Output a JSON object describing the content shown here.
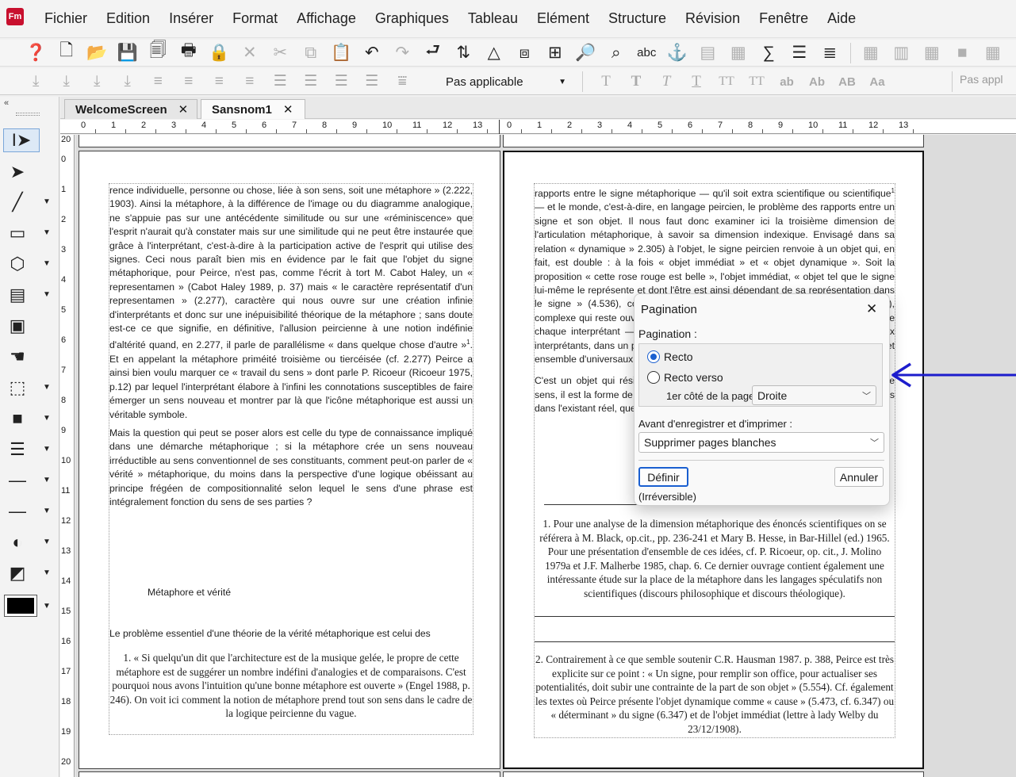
{
  "menubar": {
    "logo": "Fm",
    "items": [
      "Fichier",
      "Edition",
      "Insérer",
      "Format",
      "Affichage",
      "Graphiques",
      "Tableau",
      "Elément",
      "Structure",
      "Révision",
      "Fenêtre",
      "Aide"
    ]
  },
  "toolbar2": {
    "paragraph_format": "Pas applicable",
    "character_format": "Pas appl"
  },
  "tabs": [
    {
      "label": "WelcomeScreen",
      "close": "✕"
    },
    {
      "label": "Sansnom1",
      "close": "✕"
    }
  ],
  "ruler": {
    "h_left": [
      "0",
      "1",
      "2",
      "3",
      "4",
      "5",
      "6",
      "7",
      "8",
      "9",
      "10",
      "11",
      "12",
      "13"
    ],
    "h_right": [
      "0",
      "1",
      "2",
      "3",
      "4",
      "5",
      "6",
      "7",
      "8",
      "9",
      "10",
      "11",
      "12",
      "13"
    ],
    "v": [
      "20",
      "0",
      "1",
      "2",
      "3",
      "4",
      "5",
      "6",
      "7",
      "8",
      "9",
      "10",
      "11",
      "12",
      "13",
      "14",
      "15",
      "16",
      "17",
      "18",
      "19",
      "20"
    ]
  },
  "left_page": {
    "para1": "rence individuelle, personne ou chose, liée à son sens, soit une métaphore » (2.222, 1903). Ainsi la métaphore, à la différence de l'image ou du diagramme analogique, ne s'appuie pas sur une antécédente similitude ou sur une «réminiscence» que l'esprit n'aurait qu'à constater mais sur une similitude qui ne peut être instaurée que grâce à l'interprétant, c'est-à-dire à la participation active de l'esprit qui utilise des signes. Ceci nous paraît bien mis en évidence par le fait que l'objet du signe métaphorique, pour Peirce, n'est pas, comme l'écrit à tort M. Cabot Haley, un « representamen » (Cabot Haley 1989, p. 37) mais « le caractère représentatif d'un representamen » (2.277), caractère qui nous ouvre sur une création infinie d'interprétants et donc sur une inépuisibilité théorique de la métaphore ; sans doute est-ce ce que signifie, en définitive, l'allusion peircienne à une notion indéfinie d'altérité quand, en 2.277, il parle de parallélisme « dans quelque chose d'autre »",
    "para1_sup": "1",
    "para1_end": ". Et en appelant la métaphore priméité troisième ou tiercéisée (cf. 2.277) Peirce a ainsi bien voulu marquer ce « travail du sens » dont parle P. Ricoeur (Ricoeur 1975, p.12) par lequel l'interprétant élabore à l'infini les connotations susceptibles de faire émerger un sens nouveau et montrer par là que l'icône métaphorique est aussi un véritable symbole.",
    "para2": "Mais la question qui peut se poser alors est celle du type de connaissance impliqué dans une démarche métaphorique ; si la métaphore crée un sens nouveau irréductible au sens conventionnel de ses constituants, comment peut-on parler de « vérité » métaphorique, du moins dans la perspective d'une logique obéissant au principe frégéen de compositionnalité selon lequel le sens d'une phrase est intégralement fonction du sens de ses parties ?",
    "heading": "Métaphore et vérité",
    "para3": "Le problème essentiel d'une théorie de la vérité métaphorique est celui des",
    "footnote1": "1. « Si quelqu'un dit que l'architecture est de la musique gelée, le propre de cette métaphore est de suggérer un nombre indéfini d'analogies et de comparaisons. C'est pourquoi nous avons l'intuition qu'une bonne métaphore est ouverte » (Engel 1988, p. 246). On voit ici comment la notion de métaphore prend tout son sens dans le cadre de la logique peircienne du vague."
  },
  "right_page": {
    "para1": "rapports entre le signe métaphorique — qu'il soit extra scientifique ou scientifique",
    "para1_sup": "1",
    "para1_end": " — et le monde, c'est-à-dire, en langage peircien, le problème des rapports entre un signe et son objet. Il nous faut donc examiner ici la troisième dimension de l'articulation métaphorique, à savoir sa dimension indexique. Envisagé dans sa relation « dynamique » 2.305) à l'objet, le signe peircien renvoie à un objet qui, en fait, est double : à la fois « objet immédiat » et « objet dynamique ». Soit la proposition « cette rose rouge est belle », l'objet immédiat, « objet tel que le signe lui-même le représente et dont l'être est ainsi dépendant de sa représentation dans le signe » (4.536), comme un complexe de qualités (rose, rouge et beauté), complexe qui reste ouvert à un processus d'enrichissement au fur et à mesure que chaque interprétant — chaque nouvel interprétant — le renvoie à de nouveaux interprétants, dans un processus d'interprétation de plus en plus riche qui fait de cet ensemble d'universaux une simple représentation et, comme tel, relatif.",
    "para2": "C'est un objet qui résiste à la clôture d'un processus d'interprétation",
    "para2_sup": "2",
    "para2_end": " : dans ce sens, il est la forme de la persistance de l'objet dynamique, l'incarnation de qualités dans l'existant réel, quelque chose de bleu.",
    "footnote1": "1. Pour une analyse de la dimension métaphorique des énoncés scientifiques on se référera à M. Black, op.cit., pp. 236-241 et Mary B. Hesse, in Bar-Hillel (ed.) 1965. Pour une présentation d'ensemble de ces idées, cf. P. Ricoeur, op. cit., J. Molino 1979a et J.F. Malherbe 1985, chap. 6. Ce dernier ouvrage contient également une intéressante étude sur la place de la métaphore dans les langages spéculatifs non scientifiques (discours philosophique et discours théologique).",
    "footnote2": "2. Contrairement à ce que semble soutenir C.R. Hausman 1987. p. 388, Peirce est très explicite sur ce point : « Un signe, pour remplir son office, pour actualiser ses potentialités, doit subir une contrainte de la part de son objet » (5.554). Cf. également les textes où Peirce présente l'objet dynamique comme « cause » (5.473, cf. 6.347) ou « déterminant » du signe (6.347) et de l'objet immédiat (lettre à lady Welby du 23/12/1908)."
  },
  "dialog": {
    "title": "Pagination",
    "close": "✕",
    "section_label": "Pagination :",
    "radio_recto": "Recto",
    "radio_recto_verso": "Recto verso",
    "recto_selected": true,
    "first_side_label": "1er côté de la page :",
    "first_side_value": "Droite",
    "before_save_label": "Avant d'enregistrer et d'imprimer :",
    "before_save_value": "Supprimer pages blanches",
    "define_button": "Définir",
    "cancel_button": "Annuler",
    "irreversible_note": "(Irréversible)"
  },
  "colors": {
    "annotation_arrow": "#1c1ccc",
    "radio_accent": "#1a5fd0",
    "logo": "#c8102e"
  }
}
